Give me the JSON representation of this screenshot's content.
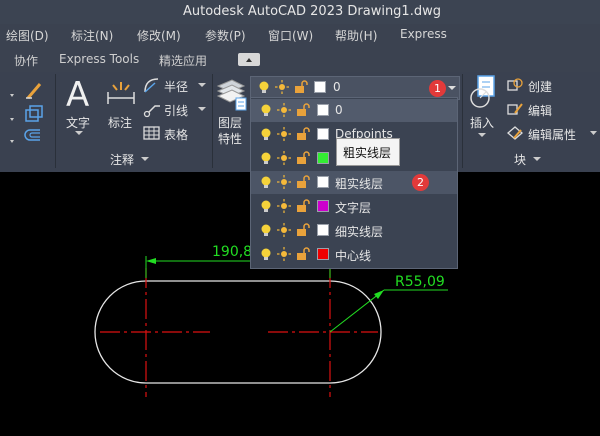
{
  "window": {
    "title": "Autodesk AutoCAD 2023    Drawing1.dwg"
  },
  "menu": [
    "绘图(D)",
    "标注(N)",
    "修改(M)",
    "参数(P)",
    "窗口(W)",
    "帮助(H)",
    "Express"
  ],
  "tabs": [
    "协作",
    "Express Tools",
    "精选应用"
  ],
  "ribbon": {
    "anno": {
      "text": "文字",
      "dim": "标注",
      "leader": "引线",
      "radius": "半径",
      "table": "表格",
      "panel": "注释"
    },
    "layer_prop": [
      "图层",
      "特性"
    ],
    "block": {
      "insert": "插入",
      "create": "创建",
      "edit": "编辑",
      "edit_attr": "编辑属性",
      "panel": "块"
    }
  },
  "layer_dropdown": {
    "current": {
      "name": "0",
      "color": "#ffffff"
    },
    "items": [
      {
        "name": "0",
        "color": "#ffffff"
      },
      {
        "name": "Defpoints",
        "color": "#ffffff"
      },
      {
        "name": "",
        "color": "#33ee33"
      },
      {
        "name": "粗实线层",
        "color": "#ffffff"
      },
      {
        "name": "文字层",
        "color": "#cc00cc"
      },
      {
        "name": "细实线层",
        "color": "#ffffff"
      },
      {
        "name": "中心线",
        "color": "#ee0000"
      }
    ],
    "tooltip": "粗实线层",
    "badges": [
      "1",
      "2"
    ]
  },
  "drawing": {
    "dim_linear": "190,8",
    "dim_radius": "R55,09"
  },
  "colors": {
    "dimension": "#22dd22",
    "centerline": "#dd1111",
    "outline": "#e6e6e6",
    "badge": "#e23a3a"
  }
}
